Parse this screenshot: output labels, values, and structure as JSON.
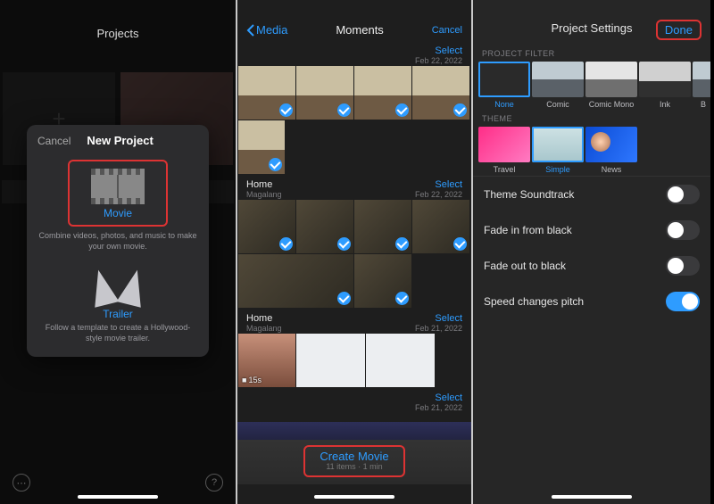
{
  "p1": {
    "screen_title": "Projects",
    "sheet": {
      "cancel": "Cancel",
      "title": "New Project",
      "movie": {
        "label": "Movie",
        "desc": "Combine videos, photos, and music to make your own movie."
      },
      "trailer": {
        "label": "Trailer",
        "desc": "Follow a template to create a Hollywood-style movie trailer."
      }
    }
  },
  "p2": {
    "back": "Media",
    "title": "Moments",
    "cancel": "Cancel",
    "sections": [
      {
        "select": "Select",
        "date": "Feb 22, 2022"
      },
      {
        "name": "Home",
        "sub": "Magalang",
        "select": "Select",
        "date": "Feb 22, 2022"
      },
      {
        "name": "Home",
        "sub": "Magalang",
        "select": "Select",
        "date": "Feb 21, 2022"
      },
      {
        "select": "Select",
        "date": "Feb 21, 2022"
      }
    ],
    "clip_dur": "15s",
    "create": {
      "label": "Create Movie",
      "sub": "11 items · 1 min"
    }
  },
  "p3": {
    "title": "Project Settings",
    "done": "Done",
    "filter_label": "PROJECT FILTER",
    "filters": [
      {
        "name": "None",
        "sel": true
      },
      {
        "name": "Comic"
      },
      {
        "name": "Comic Mono"
      },
      {
        "name": "Ink"
      },
      {
        "name": "B"
      }
    ],
    "theme_label": "THEME",
    "themes": [
      {
        "name": "Travel"
      },
      {
        "name": "Simple",
        "sel": true
      },
      {
        "name": "News"
      }
    ],
    "rows": [
      {
        "label": "Theme Soundtrack",
        "on": false
      },
      {
        "label": "Fade in from black",
        "on": false
      },
      {
        "label": "Fade out to black",
        "on": false
      },
      {
        "label": "Speed changes pitch",
        "on": true
      }
    ]
  }
}
